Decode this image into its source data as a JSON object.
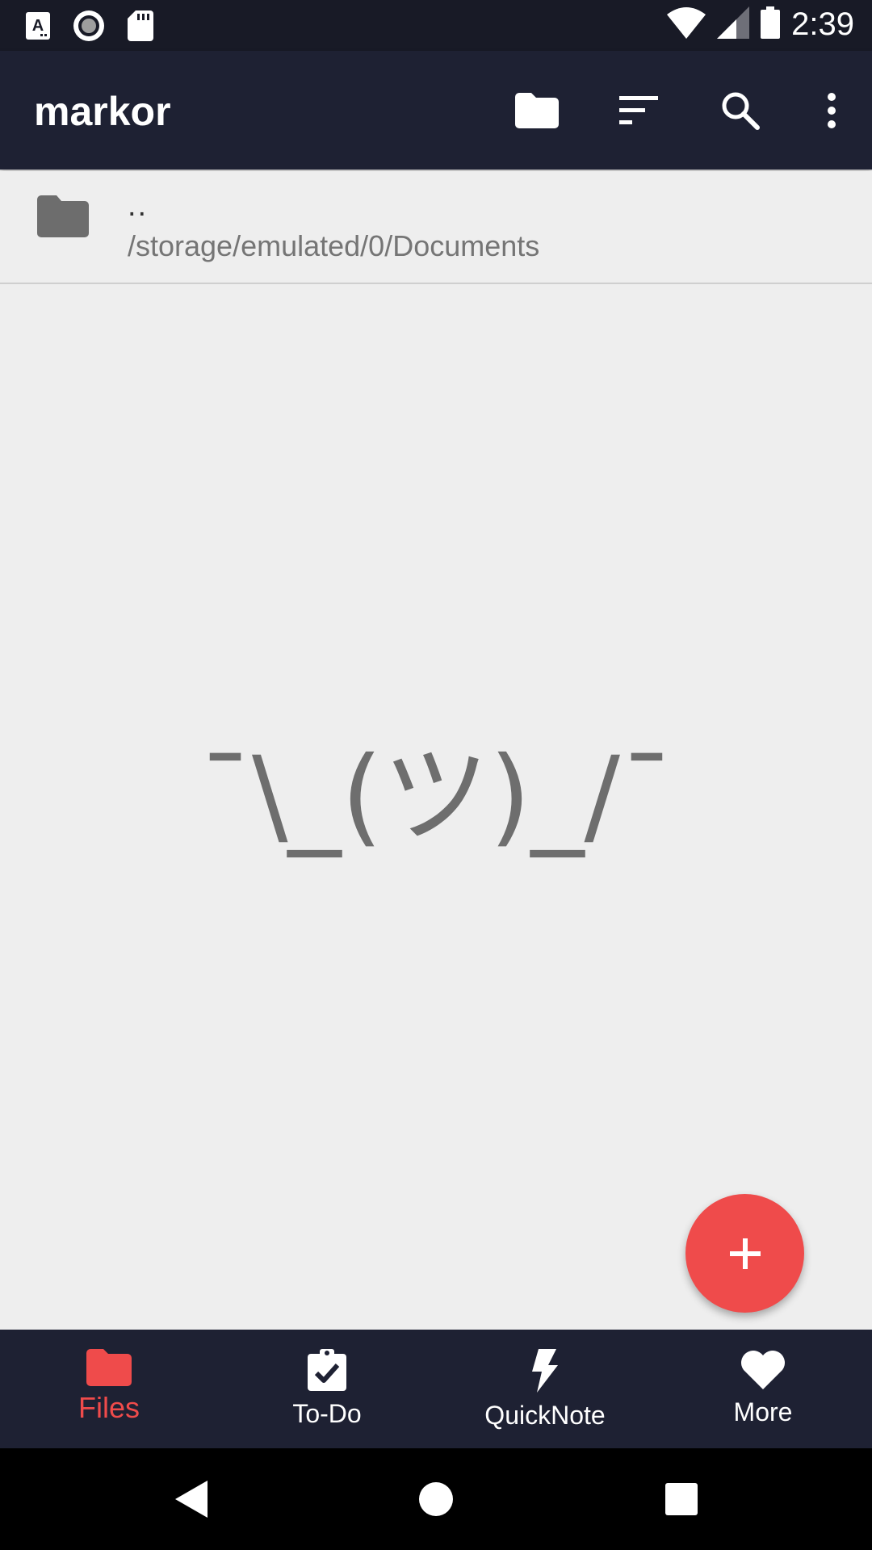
{
  "status_bar": {
    "time": "2:39",
    "left_icons": [
      "a-letter-icon",
      "record-icon",
      "sd-card-icon"
    ],
    "right_icons": [
      "wifi-icon",
      "cell-signal-icon",
      "battery-icon"
    ]
  },
  "app_bar": {
    "title": "markor",
    "actions": [
      "folder-icon",
      "sort-icon",
      "search-icon",
      "more-vert-icon"
    ]
  },
  "file_list": {
    "parent_item": {
      "name": "..",
      "path": "/storage/emulated/0/Documents"
    }
  },
  "empty_state": {
    "text": "¯\\_(ツ)_/¯"
  },
  "fab": {
    "icon": "plus-icon"
  },
  "bottom_nav": {
    "items": [
      {
        "label": "Files",
        "icon": "folder-icon",
        "active": true
      },
      {
        "label": "To-Do",
        "icon": "clipboard-check-icon",
        "active": false
      },
      {
        "label": "QuickNote",
        "icon": "bolt-icon",
        "active": false
      },
      {
        "label": "More",
        "icon": "heart-icon",
        "active": false
      }
    ]
  },
  "colors": {
    "app_bar": "#1e2133",
    "status_bar": "#181a26",
    "accent": "#ef4b4b",
    "background": "#eeeeee"
  }
}
